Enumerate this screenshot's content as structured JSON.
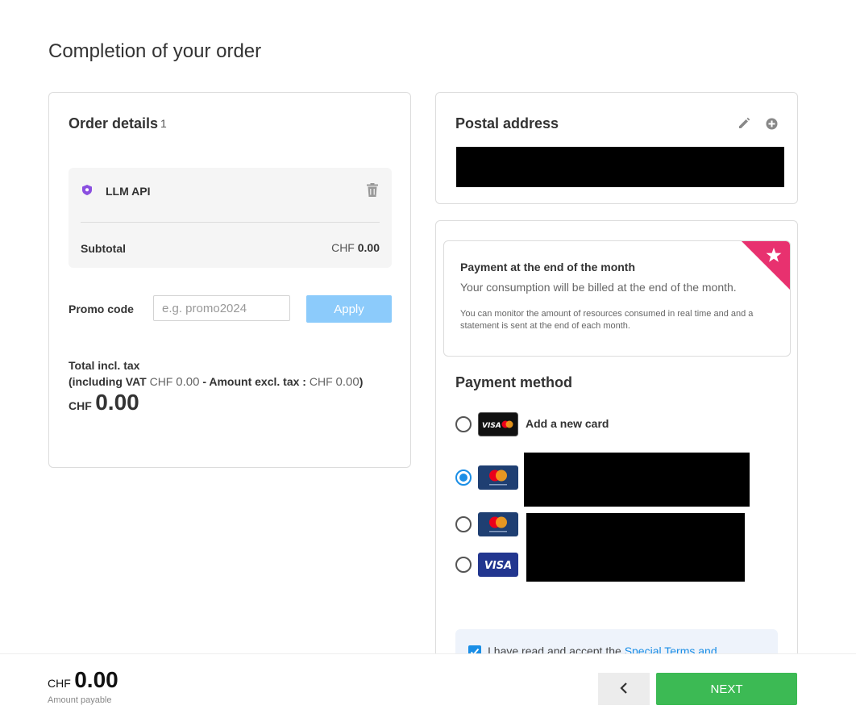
{
  "page": {
    "title": "Completion of your order"
  },
  "order": {
    "title": "Order details",
    "count": "1",
    "product_name": "LLM API",
    "product_icon": "shield-icon",
    "delete_icon": "trash-icon",
    "subtotal_label": "Subtotal",
    "subtotal_currency": "CHF",
    "subtotal_value": "0.00",
    "promo_label": "Promo code",
    "promo_placeholder": "e.g. promo2024",
    "promo_value": "",
    "apply_label": "Apply",
    "total_label": "Total incl. tax",
    "vat_prefix": "(including VAT",
    "vat_currency": "CHF",
    "vat_value": "0.00",
    "excl_label": "- Amount excl. tax :",
    "excl_currency": "CHF",
    "excl_value": "0.00",
    "vat_suffix": ")",
    "total_currency": "CHF",
    "total_value": "0.00"
  },
  "postal": {
    "title": "Postal address",
    "edit_icon": "pencil-icon",
    "add_icon": "plus-circle-icon"
  },
  "billing": {
    "title": "Payment at the end of the month",
    "subtitle": "Your consumption will be billed at the end of the month.",
    "note": "You can monitor the amount of resources consumed in real time and and a statement is sent at the end of each month.",
    "badge_icon": "star-icon",
    "badge_color": "#e8316f"
  },
  "payment": {
    "title": "Payment method",
    "add_card_label": "Add a new card",
    "options": [
      {
        "brand": "visa-mastercard",
        "selected": false
      },
      {
        "brand": "mastercard",
        "selected": true
      },
      {
        "brand": "mastercard",
        "selected": false
      },
      {
        "brand": "visa",
        "selected": false
      }
    ],
    "visa_text": "VISA"
  },
  "terms": {
    "text": "I have read and accept the",
    "link": "Special Terms and",
    "checked": true
  },
  "footer": {
    "currency": "CHF",
    "amount": "0.00",
    "caption": "Amount payable",
    "back_icon": "chevron-left-icon",
    "next_label": "NEXT"
  },
  "colors": {
    "accent": "#1a8ee6",
    "next": "#3cba54",
    "apply": "#8ccbfb",
    "product_icon": "#8a4fe0"
  }
}
